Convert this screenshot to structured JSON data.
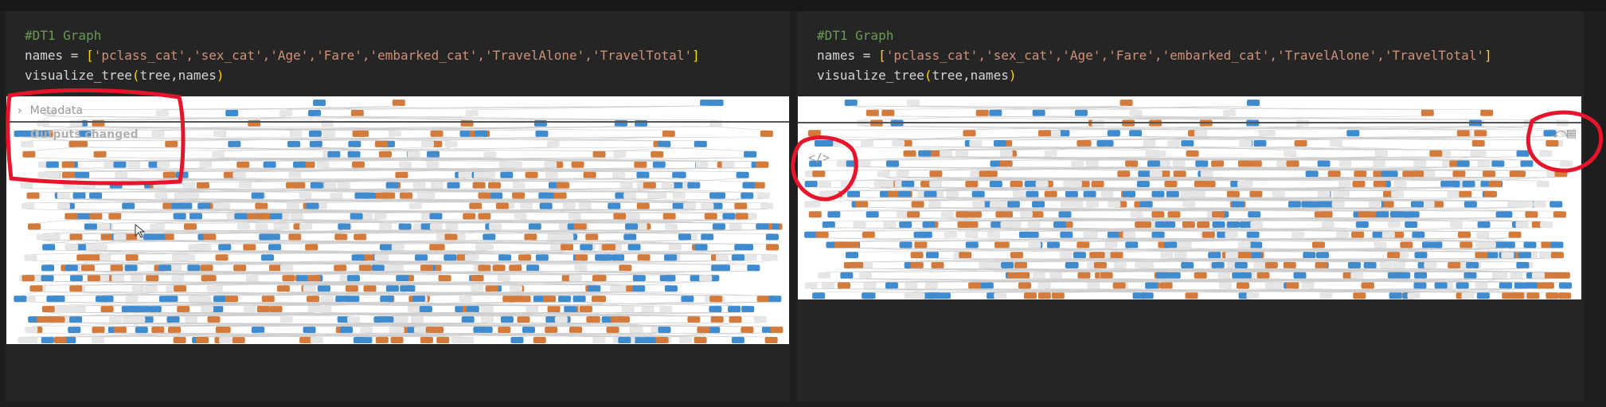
{
  "left_cell": {
    "comment": "#DT1 Graph",
    "line2": {
      "var": "names",
      "op": " = ",
      "open": "[",
      "items": "'pclass_cat','sex_cat','Age','Fare','embarked_cat','TravelAlone','TravelTotal'",
      "close": "]"
    },
    "line3": {
      "fn": "visualize_tree",
      "open": "(",
      "args": "tree,names",
      "close": ")"
    },
    "metadata_label": "Metadata",
    "outputs_changed_label": "Outputs changed"
  },
  "right_cell": {
    "comment": "#DT1 Graph",
    "line2": {
      "var": "names",
      "op": " = ",
      "open": "[",
      "items": "'pclass_cat','sex_cat','Age','Fare','embarked_cat','TravelAlone','TravelTotal'",
      "close": "]"
    },
    "line3": {
      "fn": "visualize_tree",
      "open": "(",
      "args": "tree,names",
      "close": ")"
    },
    "code_icon": "</>",
    "toolbar_icons": [
      "undo-icon",
      "output-toggle-icon"
    ]
  },
  "colors": {
    "blue_node": "#3f8bcf",
    "orange_node": "#d47b3b",
    "light_node": "#e6e6e6",
    "annotation_red": "#e8142b"
  }
}
